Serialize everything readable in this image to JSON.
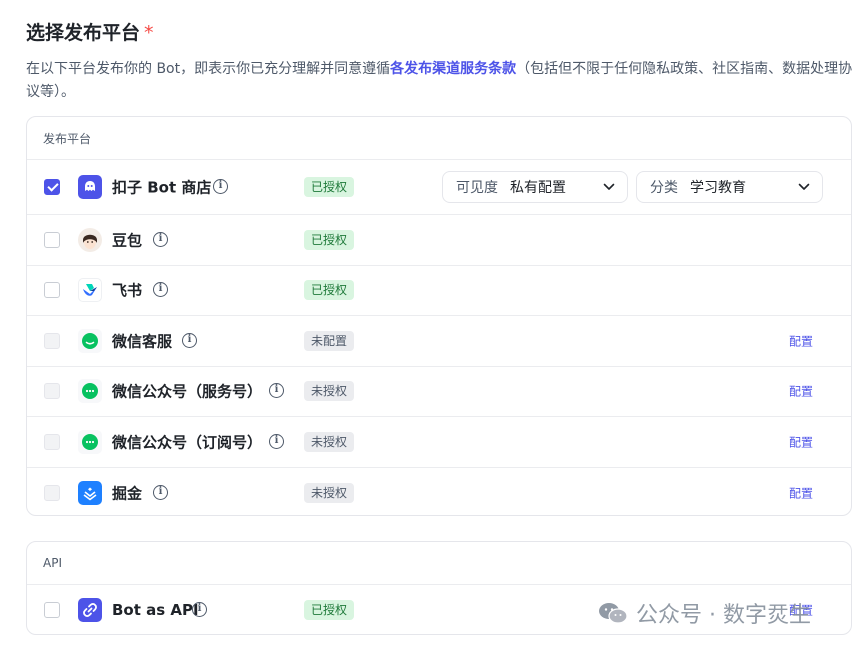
{
  "header": {
    "title": "选择发布平台",
    "required_mark": "*",
    "desc_before": "在以下平台发布你的 Bot，即表示你已充分理解并同意遵循",
    "desc_link": "各发布渠道服务条款",
    "desc_after": "（包括但不限于任何隐私政策、社区指南、数据处理协议等）。"
  },
  "platforms": {
    "section_title": "发布平台",
    "rows": [
      {
        "name": "扣子 Bot 商店",
        "status": "已授权",
        "checked": true,
        "disabled": false,
        "icon": "coze-bot-store-icon",
        "brand_color": "#4d53e8"
      },
      {
        "name": "豆包",
        "status": "已授权",
        "checked": false,
        "disabled": false,
        "icon": "doubao-avatar-icon"
      },
      {
        "name": "飞书",
        "status": "已授权",
        "checked": false,
        "disabled": false,
        "icon": "feishu-icon"
      },
      {
        "name": "微信客服",
        "status": "未配置",
        "checked": false,
        "disabled": true,
        "icon": "wechat-icon",
        "action": "配置"
      },
      {
        "name": "微信公众号（服务号）",
        "status": "未授权",
        "checked": false,
        "disabled": true,
        "icon": "wechat-icon",
        "action": "配置"
      },
      {
        "name": "微信公众号（订阅号）",
        "status": "未授权",
        "checked": false,
        "disabled": true,
        "icon": "wechat-icon",
        "action": "配置"
      },
      {
        "name": "掘金",
        "status": "未授权",
        "checked": false,
        "disabled": true,
        "icon": "juejin-icon",
        "action": "配置"
      }
    ],
    "visibility": {
      "label": "可见度",
      "value": "私有配置"
    },
    "category": {
      "label": "分类",
      "value": "学习教育"
    }
  },
  "api": {
    "section_title": "API",
    "rows": [
      {
        "name": "Bot as API",
        "status": "已授权",
        "checked": false,
        "disabled": false,
        "icon": "api-link-icon",
        "action": "配置"
      }
    ]
  },
  "watermark": {
    "text": "公众号 · 数字烎生"
  },
  "colors": {
    "accent": "#4d53e8",
    "authorized_bg": "#d9f5e0",
    "authorized_text": "#1f7a3a",
    "unauthorized_bg": "#ebecef",
    "wechat_green": "#07c160",
    "required": "#f54a45"
  }
}
